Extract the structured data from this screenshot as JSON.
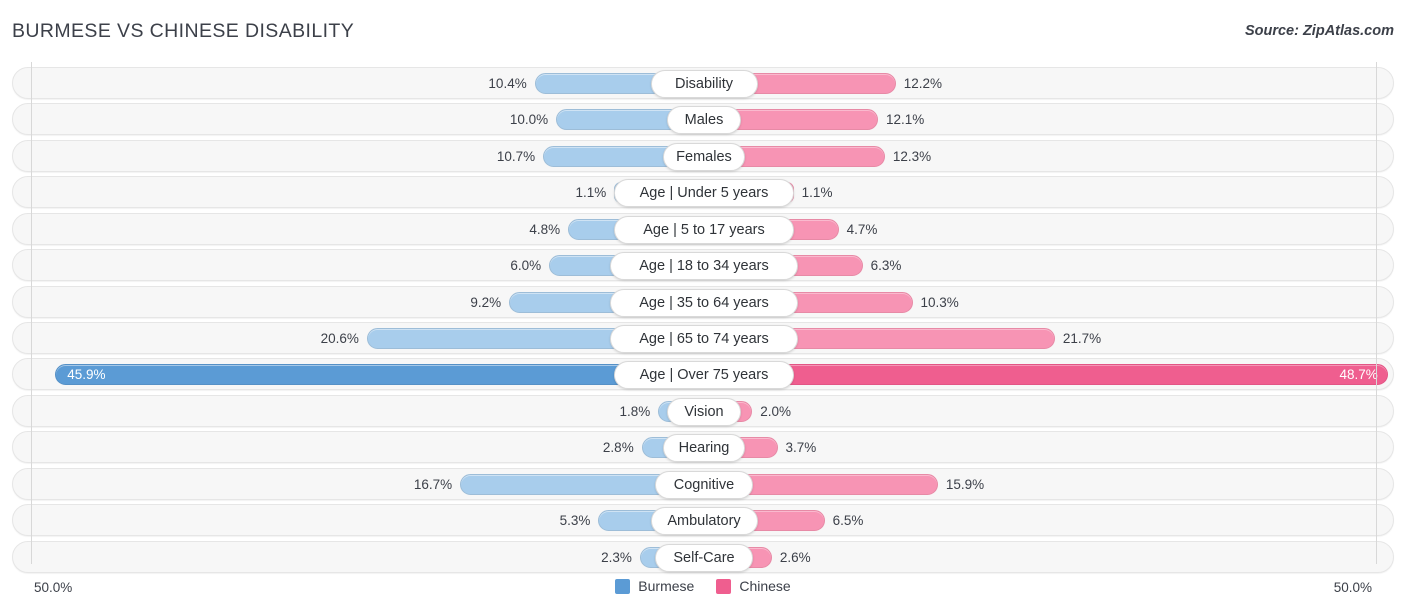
{
  "header": {
    "title": "BURMESE VS CHINESE DISABILITY",
    "source": "Source: ZipAtlas.com"
  },
  "axis": {
    "left_label": "50.0%",
    "right_label": "50.0%",
    "max": 50.0
  },
  "legend": [
    {
      "label": "Burmese",
      "color": "#5b9bd5"
    },
    {
      "label": "Chinese",
      "color": "#ef5e8f"
    }
  ],
  "colors": {
    "left_bar": "#a8cdec",
    "right_bar": "#f794b4",
    "left_bar_max": "#5b9bd5",
    "right_bar_max": "#ef5e8f",
    "row_bg": "#f7f7f7",
    "text": "#3c4049"
  },
  "chart_data": {
    "type": "bar",
    "title": "BURMESE VS CHINESE DISABILITY",
    "subtitle": "Source: ZipAtlas.com",
    "orientation": "horizontal-diverging",
    "xlabel": "",
    "ylabel": "",
    "xlim": [
      50.0,
      50.0
    ],
    "grid": false,
    "legend_position": "bottom-center",
    "categories": [
      "Disability",
      "Males",
      "Females",
      "Age | Under 5 years",
      "Age | 5 to 17 years",
      "Age | 18 to 34 years",
      "Age | 35 to 64 years",
      "Age | 65 to 74 years",
      "Age | Over 75 years",
      "Vision",
      "Hearing",
      "Cognitive",
      "Ambulatory",
      "Self-Care"
    ],
    "series": [
      {
        "name": "Burmese",
        "color": "#5b9bd5",
        "values": [
          10.4,
          10.0,
          10.7,
          1.1,
          4.8,
          6.0,
          9.2,
          20.6,
          45.9,
          1.8,
          2.8,
          16.7,
          5.3,
          2.3
        ],
        "labels": [
          "10.4%",
          "10.0%",
          "10.7%",
          "1.1%",
          "4.8%",
          "6.0%",
          "9.2%",
          "20.6%",
          "45.9%",
          "1.8%",
          "2.8%",
          "16.7%",
          "5.3%",
          "2.3%"
        ]
      },
      {
        "name": "Chinese",
        "color": "#ef5e8f",
        "values": [
          12.2,
          12.1,
          12.3,
          1.1,
          4.7,
          6.3,
          10.3,
          21.7,
          48.7,
          2.0,
          3.7,
          15.9,
          6.5,
          2.6
        ],
        "labels": [
          "12.2%",
          "12.1%",
          "12.3%",
          "1.1%",
          "4.7%",
          "6.3%",
          "10.3%",
          "21.7%",
          "48.7%",
          "2.0%",
          "3.7%",
          "15.9%",
          "6.5%",
          "2.6%"
        ]
      }
    ],
    "highlight_row_index": 8
  }
}
